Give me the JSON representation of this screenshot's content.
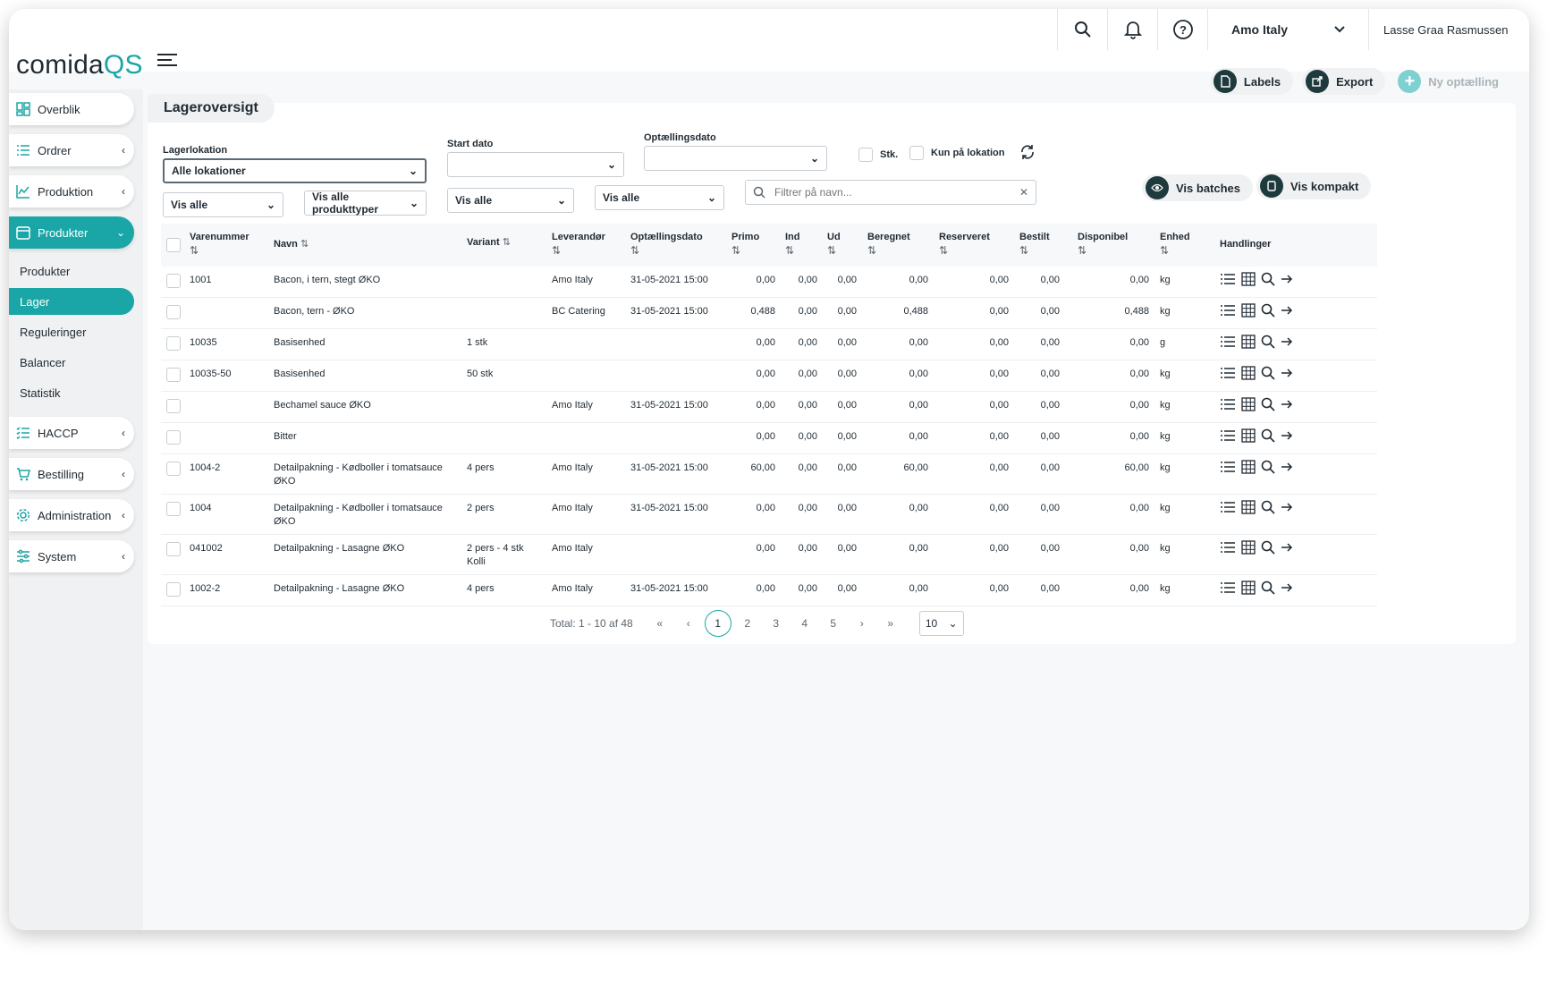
{
  "app": {
    "brand_a": "comida",
    "brand_b": "QS"
  },
  "topbar": {
    "location": "Amo Italy",
    "user": "Lasse Graa Rasmussen"
  },
  "sidebar": {
    "items": [
      {
        "label": "Overblik"
      },
      {
        "label": "Ordrer"
      },
      {
        "label": "Produktion"
      },
      {
        "label": "Produkter"
      },
      {
        "label": "HACCP"
      },
      {
        "label": "Bestilling"
      },
      {
        "label": "Administration"
      },
      {
        "label": "System"
      }
    ],
    "subitems": [
      {
        "label": "Produkter"
      },
      {
        "label": "Lager"
      },
      {
        "label": "Reguleringer"
      },
      {
        "label": "Balancer"
      },
      {
        "label": "Statistik"
      }
    ]
  },
  "actions": {
    "labels": "Labels",
    "export": "Export",
    "new": "Ny optælling"
  },
  "page": {
    "title": "Lageroversigt"
  },
  "filters": {
    "lagerlokation_label": "Lagerlokation",
    "lagerlokation_value": "Alle lokationer",
    "start_dato_label": "Start dato",
    "optaelling_label": "Optællingsdato",
    "stk_label": "Stk.",
    "kun_label": "Kun på lokation",
    "vis_alle_1": "Vis alle",
    "produkttyper": "Vis alle produkttyper",
    "vis_alle_2": "Vis alle",
    "vis_alle_3": "Vis alle",
    "search_placeholder": "Filtrer på navn...",
    "vis_batches": "Vis batches",
    "vis_kompakt": "Vis kompakt"
  },
  "table": {
    "headers": {
      "varenummer": "Varenummer",
      "navn": "Navn",
      "variant": "Variant",
      "leverandor": "Leverandør",
      "optaellingsdato": "Optællingsdato",
      "primo": "Primo",
      "ind": "Ind",
      "ud": "Ud",
      "beregnet": "Beregnet",
      "reserveret": "Reserveret",
      "bestilt": "Bestilt",
      "disponibel": "Disponibel",
      "enhed": "Enhed",
      "handlinger": "Handlinger"
    },
    "rows": [
      {
        "nr": "1001",
        "navn": "Bacon, i tern, stegt ØKO",
        "variant": "",
        "lev": "Amo Italy",
        "dato": "31-05-2021 15:00",
        "primo": "0,00",
        "ind": "0,00",
        "ud": "0,00",
        "ber": "0,00",
        "res": "0,00",
        "best": "0,00",
        "disp": "0,00",
        "enh": "kg"
      },
      {
        "nr": "",
        "navn": "Bacon, tern - ØKO",
        "variant": "",
        "lev": "BC Catering",
        "dato": "31-05-2021 15:00",
        "primo": "0,488",
        "ind": "0,00",
        "ud": "0,00",
        "ber": "0,488",
        "res": "0,00",
        "best": "0,00",
        "disp": "0,488",
        "enh": "kg"
      },
      {
        "nr": "10035",
        "navn": "Basisenhed",
        "variant": "1 stk",
        "lev": "",
        "dato": "",
        "primo": "0,00",
        "ind": "0,00",
        "ud": "0,00",
        "ber": "0,00",
        "res": "0,00",
        "best": "0,00",
        "disp": "0,00",
        "enh": "g"
      },
      {
        "nr": "10035-50",
        "navn": "Basisenhed",
        "variant": "50 stk",
        "lev": "",
        "dato": "",
        "primo": "0,00",
        "ind": "0,00",
        "ud": "0,00",
        "ber": "0,00",
        "res": "0,00",
        "best": "0,00",
        "disp": "0,00",
        "enh": "kg"
      },
      {
        "nr": "",
        "navn": "Bechamel sauce ØKO",
        "variant": "",
        "lev": "Amo Italy",
        "dato": "31-05-2021 15:00",
        "primo": "0,00",
        "ind": "0,00",
        "ud": "0,00",
        "ber": "0,00",
        "res": "0,00",
        "best": "0,00",
        "disp": "0,00",
        "enh": "kg"
      },
      {
        "nr": "",
        "navn": "Bitter",
        "variant": "",
        "lev": "",
        "dato": "",
        "primo": "0,00",
        "ind": "0,00",
        "ud": "0,00",
        "ber": "0,00",
        "res": "0,00",
        "best": "0,00",
        "disp": "0,00",
        "enh": "kg"
      },
      {
        "nr": "1004-2",
        "navn": "Detailpakning - Kødboller i tomatsauce ØKO",
        "variant": "4 pers",
        "lev": "Amo Italy",
        "dato": "31-05-2021 15:00",
        "primo": "60,00",
        "ind": "0,00",
        "ud": "0,00",
        "ber": "60,00",
        "res": "0,00",
        "best": "0,00",
        "disp": "60,00",
        "enh": "kg"
      },
      {
        "nr": "1004",
        "navn": "Detailpakning - Kødboller i tomatsauce ØKO",
        "variant": "2 pers",
        "lev": "Amo Italy",
        "dato": "31-05-2021 15:00",
        "primo": "0,00",
        "ind": "0,00",
        "ud": "0,00",
        "ber": "0,00",
        "res": "0,00",
        "best": "0,00",
        "disp": "0,00",
        "enh": "kg"
      },
      {
        "nr": "041002",
        "navn": "Detailpakning - Lasagne ØKO",
        "variant": "2 pers - 4 stk Kolli",
        "lev": "Amo Italy",
        "dato": "",
        "primo": "0,00",
        "ind": "0,00",
        "ud": "0,00",
        "ber": "0,00",
        "res": "0,00",
        "best": "0,00",
        "disp": "0,00",
        "enh": "kg"
      },
      {
        "nr": "1002-2",
        "navn": "Detailpakning - Lasagne ØKO",
        "variant": "4 pers",
        "lev": "Amo Italy",
        "dato": "31-05-2021 15:00",
        "primo": "0,00",
        "ind": "0,00",
        "ud": "0,00",
        "ber": "0,00",
        "res": "0,00",
        "best": "0,00",
        "disp": "0,00",
        "enh": "kg"
      }
    ]
  },
  "pagination": {
    "total": "Total: 1 - 10 af 48",
    "pages": [
      "1",
      "2",
      "3",
      "4",
      "5"
    ],
    "page_size": "10"
  },
  "colors": {
    "accent": "#1aa6a6",
    "dark": "#1e3a3c"
  }
}
